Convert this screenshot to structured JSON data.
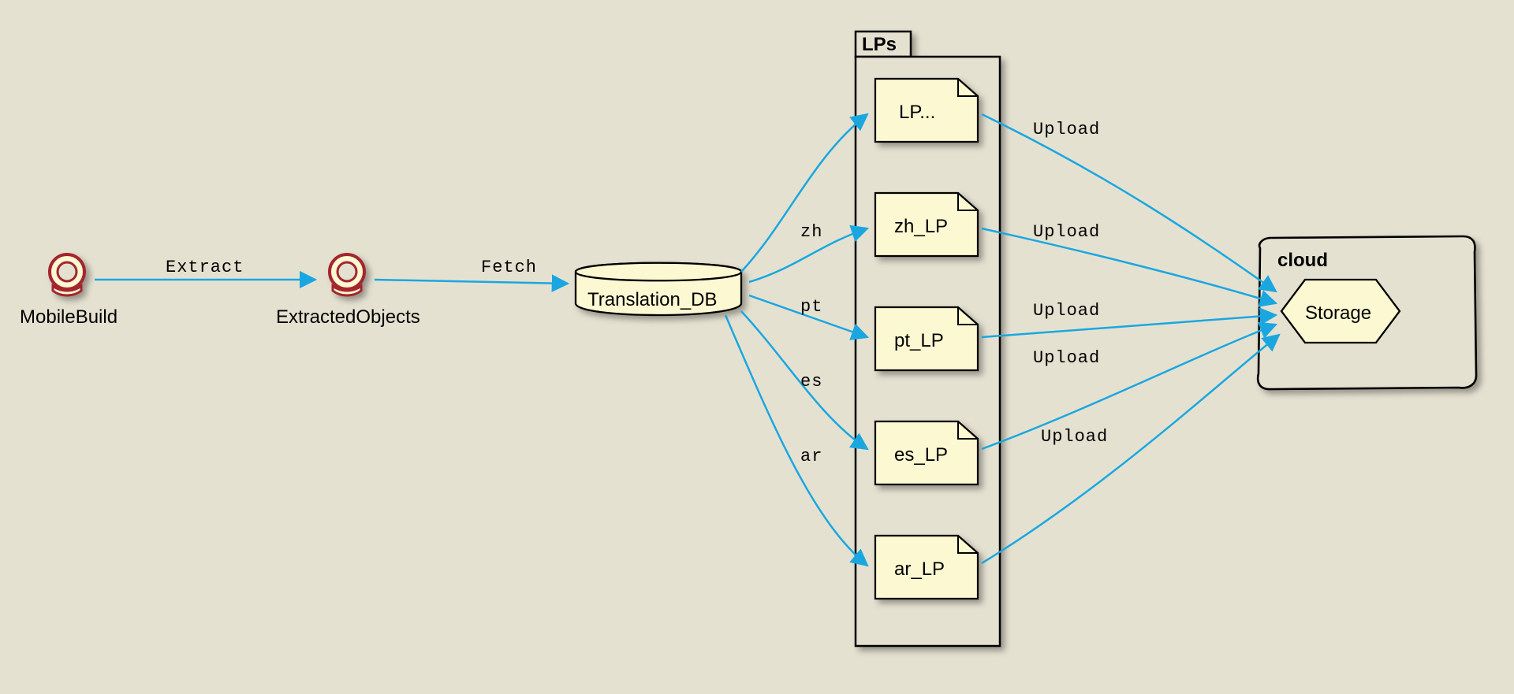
{
  "nodes": {
    "mobileBuild": "MobileBuild",
    "extractedObjects": "ExtractedObjects",
    "translationDb": "Translation_DB",
    "lpsContainer": "LPs",
    "lp0": "LP...",
    "lp1": "zh_LP",
    "lp2": "pt_LP",
    "lp3": "es_LP",
    "lp4": "ar_LP",
    "cloudContainer": "cloud",
    "storage": "Storage"
  },
  "edges": {
    "extract": "Extract",
    "fetch": "Fetch",
    "zh": "zh",
    "pt": "pt",
    "es": "es",
    "ar": "ar",
    "upload0": "Upload",
    "upload1": "Upload",
    "upload2": "Upload",
    "upload3": "Upload",
    "upload4": "Upload"
  }
}
